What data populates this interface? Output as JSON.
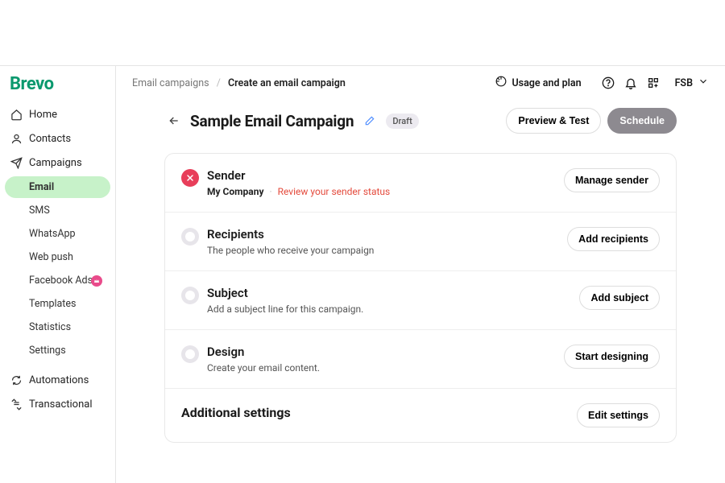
{
  "brand": "Brevo",
  "sidebar": {
    "items": [
      {
        "label": "Home",
        "icon": "home"
      },
      {
        "label": "Contacts",
        "icon": "contacts"
      },
      {
        "label": "Campaigns",
        "icon": "campaigns"
      }
    ],
    "campaign_children": [
      {
        "label": "Email",
        "active": true
      },
      {
        "label": "SMS"
      },
      {
        "label": "WhatsApp"
      },
      {
        "label": "Web push"
      },
      {
        "label": "Facebook Ads",
        "badge": true
      },
      {
        "label": "Templates"
      },
      {
        "label": "Statistics"
      },
      {
        "label": "Settings"
      }
    ],
    "items_after": [
      {
        "label": "Automations",
        "icon": "automations"
      },
      {
        "label": "Transactional",
        "icon": "transactional"
      }
    ]
  },
  "topbar": {
    "breadcrumb_parent": "Email campaigns",
    "breadcrumb_current": "Create an email campaign",
    "usage_label": "Usage and plan",
    "account_label": "FSB"
  },
  "page": {
    "title": "Sample Email Campaign",
    "status": "Draft",
    "preview_label": "Preview & Test",
    "schedule_label": "Schedule"
  },
  "steps": {
    "sender": {
      "title": "Sender",
      "from": "My Company",
      "warning": "Review your sender status",
      "action": "Manage sender"
    },
    "recipients": {
      "title": "Recipients",
      "sub": "The people who receive your campaign",
      "action": "Add recipients"
    },
    "subject": {
      "title": "Subject",
      "sub": "Add a subject line for this campaign.",
      "action": "Add subject"
    },
    "design": {
      "title": "Design",
      "sub": "Create your email content.",
      "action": "Start designing"
    },
    "extra": {
      "title": "Additional settings",
      "action": "Edit settings"
    }
  }
}
